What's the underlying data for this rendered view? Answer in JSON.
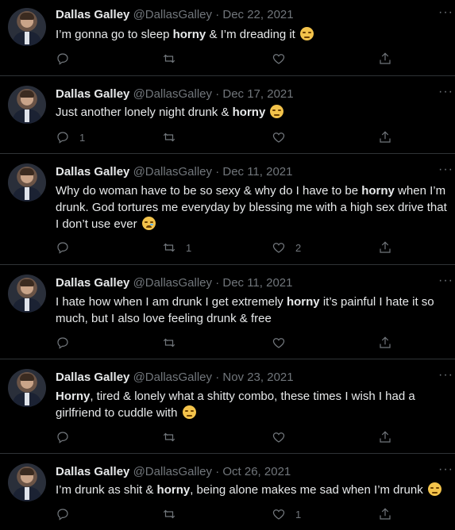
{
  "tweets": [
    {
      "name": "Dallas Galley",
      "handle": "@DallasGalley",
      "separator": "·",
      "date": "Dec 22, 2021",
      "text_parts": [
        "I’m gonna go to sleep ",
        "horny",
        " & I’m dreading it"
      ],
      "emoji": "relieved-face",
      "replies": "",
      "retweets": "",
      "likes": ""
    },
    {
      "name": "Dallas Galley",
      "handle": "@DallasGalley",
      "separator": "·",
      "date": "Dec 17, 2021",
      "text_parts": [
        "Just another lonely night drunk & ",
        "horny",
        ""
      ],
      "emoji": "rolling-eyes-face",
      "replies": "1",
      "retweets": "",
      "likes": ""
    },
    {
      "name": "Dallas Galley",
      "handle": "@DallasGalley",
      "separator": "·",
      "date": "Dec 11, 2021",
      "text_parts": [
        "Why do woman have to be so sexy & why do I have to be ",
        "horny",
        " when I’m drunk. God tortures me everyday by blessing me with a high sex drive that I don’t use ever"
      ],
      "emoji": "crying-face",
      "replies": "",
      "retweets": "1",
      "likes": "2"
    },
    {
      "name": "Dallas Galley",
      "handle": "@DallasGalley",
      "separator": "·",
      "date": "Dec 11, 2021",
      "text_parts": [
        "I hate how when I am drunk I get extremely ",
        "horny",
        " it’s painful I hate it so much, but I also love feeling drunk & free"
      ],
      "emoji": "",
      "replies": "",
      "retweets": "",
      "likes": ""
    },
    {
      "name": "Dallas Galley",
      "handle": "@DallasGalley",
      "separator": "·",
      "date": "Nov 23, 2021",
      "text_parts": [
        "",
        "Horny",
        ", tired & lonely what a shitty combo, these times I wish I had a girlfriend to cuddle with"
      ],
      "emoji": "relieved-face",
      "replies": "",
      "retweets": "",
      "likes": ""
    },
    {
      "name": "Dallas Galley",
      "handle": "@DallasGalley",
      "separator": "·",
      "date": "Oct 26, 2021",
      "text_parts": [
        "I’m drunk as shit & ",
        "horny",
        ", being alone makes me sad when I’m drunk"
      ],
      "emoji": "rolling-eyes-face",
      "replies": "",
      "retweets": "",
      "likes": "1"
    }
  ],
  "more_label": "···",
  "colors": {
    "background": "#000000",
    "text": "#e7e9ea",
    "muted": "#71767b",
    "divider": "#2f3336"
  },
  "icons": {
    "reply": "reply-icon",
    "retweet": "retweet-icon",
    "like": "heart-icon",
    "share": "share-icon",
    "more": "more-icon"
  }
}
